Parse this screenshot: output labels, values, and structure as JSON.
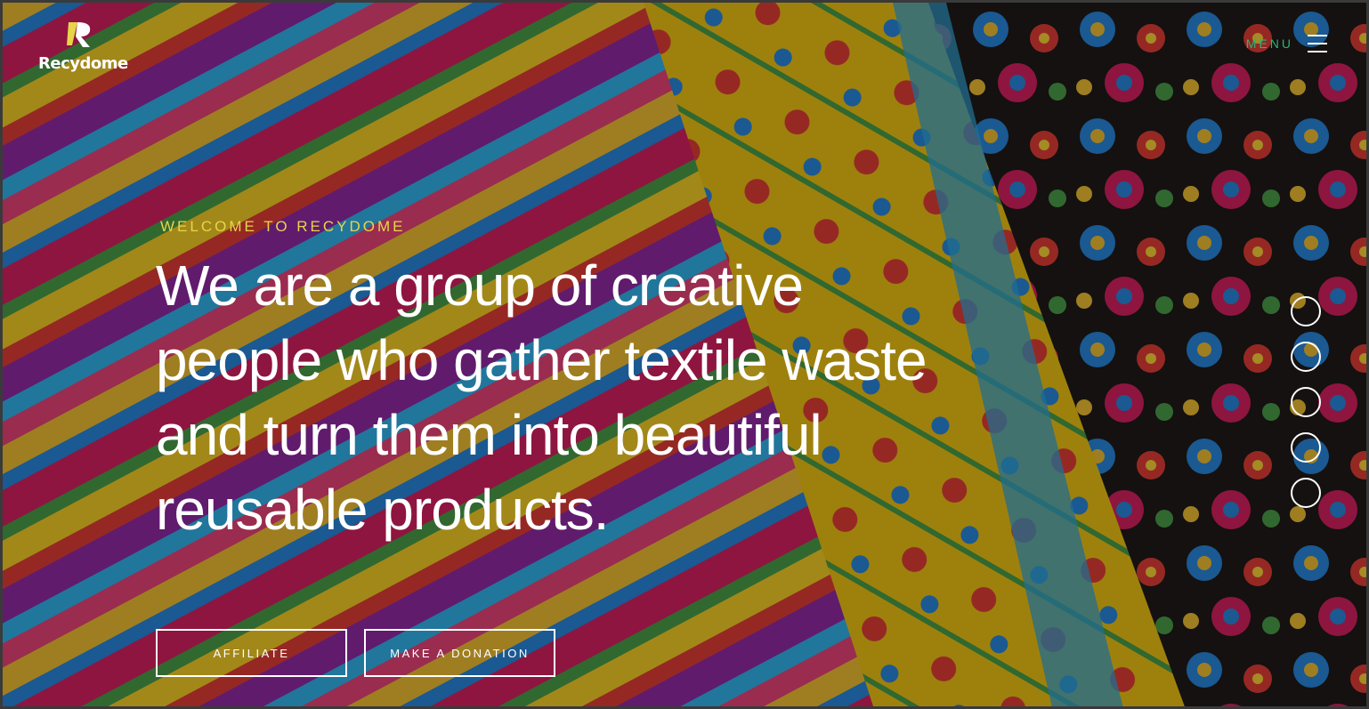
{
  "brand": {
    "name": "Recydome",
    "accent_yellow": "#e7d44a",
    "accent_green": "#2bb673"
  },
  "header": {
    "menu_label": "MENU"
  },
  "hero": {
    "eyebrow": "WELCOME TO RECYDOME",
    "headline": "We are a group of creative people who gather textile waste and turn them into beautiful reusable products.",
    "background": "colorful embroidered floral textile fabrics"
  },
  "buttons": {
    "affiliate": "AFFILIATE",
    "donate": "MAKE A DONATION"
  },
  "slider": {
    "dot_count": 5,
    "icon": "circle-outline"
  }
}
